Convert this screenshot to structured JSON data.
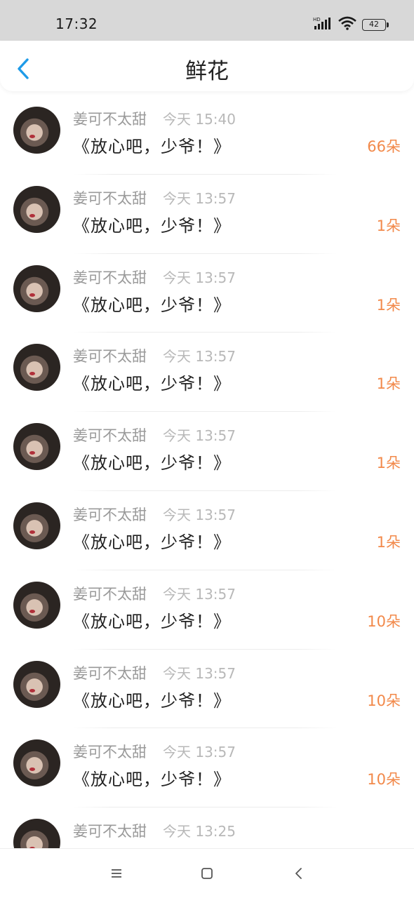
{
  "status_bar": {
    "time": "17:32",
    "battery": "42",
    "icons": [
      "hd-icon",
      "signal-icon",
      "wifi-icon",
      "battery-icon"
    ]
  },
  "header": {
    "title": "鲜花",
    "back_icon": "chevron-left-icon"
  },
  "colors": {
    "accent_blue": "#1e9be8",
    "count_orange": "#f2894a",
    "status_bar_bg": "#d8d8d8"
  },
  "items": [
    {
      "sender": "姜可不太甜",
      "time": "今天 15:40",
      "title": "《放心吧，少爷！》",
      "count": "66朵"
    },
    {
      "sender": "姜可不太甜",
      "time": "今天 13:57",
      "title": "《放心吧，少爷！》",
      "count": "1朵"
    },
    {
      "sender": "姜可不太甜",
      "time": "今天 13:57",
      "title": "《放心吧，少爷！》",
      "count": "1朵"
    },
    {
      "sender": "姜可不太甜",
      "time": "今天 13:57",
      "title": "《放心吧，少爷！》",
      "count": "1朵"
    },
    {
      "sender": "姜可不太甜",
      "time": "今天 13:57",
      "title": "《放心吧，少爷！》",
      "count": "1朵"
    },
    {
      "sender": "姜可不太甜",
      "time": "今天 13:57",
      "title": "《放心吧，少爷！》",
      "count": "1朵"
    },
    {
      "sender": "姜可不太甜",
      "time": "今天 13:57",
      "title": "《放心吧，少爷！》",
      "count": "10朵"
    },
    {
      "sender": "姜可不太甜",
      "time": "今天 13:57",
      "title": "《放心吧，少爷！》",
      "count": "10朵"
    },
    {
      "sender": "姜可不太甜",
      "time": "今天 13:57",
      "title": "《放心吧，少爷！》",
      "count": "10朵"
    },
    {
      "sender": "姜可不太甜",
      "time": "今天 13:25",
      "title": "",
      "count": ""
    }
  ],
  "nav_bar": {
    "icons": [
      "menu-icon",
      "home-icon",
      "back-icon"
    ]
  }
}
